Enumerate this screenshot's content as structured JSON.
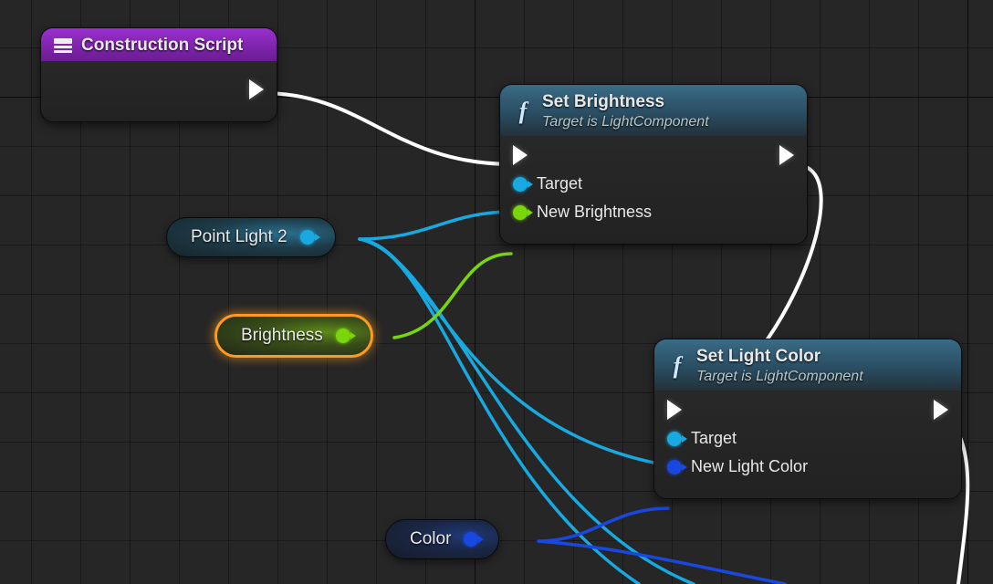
{
  "nodes": {
    "construction": {
      "title": "Construction Script"
    },
    "set_brightness": {
      "title": "Set Brightness",
      "subtitle": "Target is LightComponent",
      "pin_target": "Target",
      "pin_value": "New Brightness"
    },
    "set_light_color": {
      "title": "Set Light Color",
      "subtitle": "Target is LightComponent",
      "pin_target": "Target",
      "pin_value": "New Light Color"
    }
  },
  "variables": {
    "point_light": "Point Light 2",
    "brightness": "Brightness",
    "color": "Color"
  },
  "colors": {
    "exec_wire": "#ffffff",
    "object_wire": "#17a9e0",
    "float_wire": "#79d60c",
    "struct_wire": "#1848e0",
    "header_purple": "#8a2fc0",
    "header_blue": "#3a6b86",
    "selection": "#ff9a1f"
  }
}
